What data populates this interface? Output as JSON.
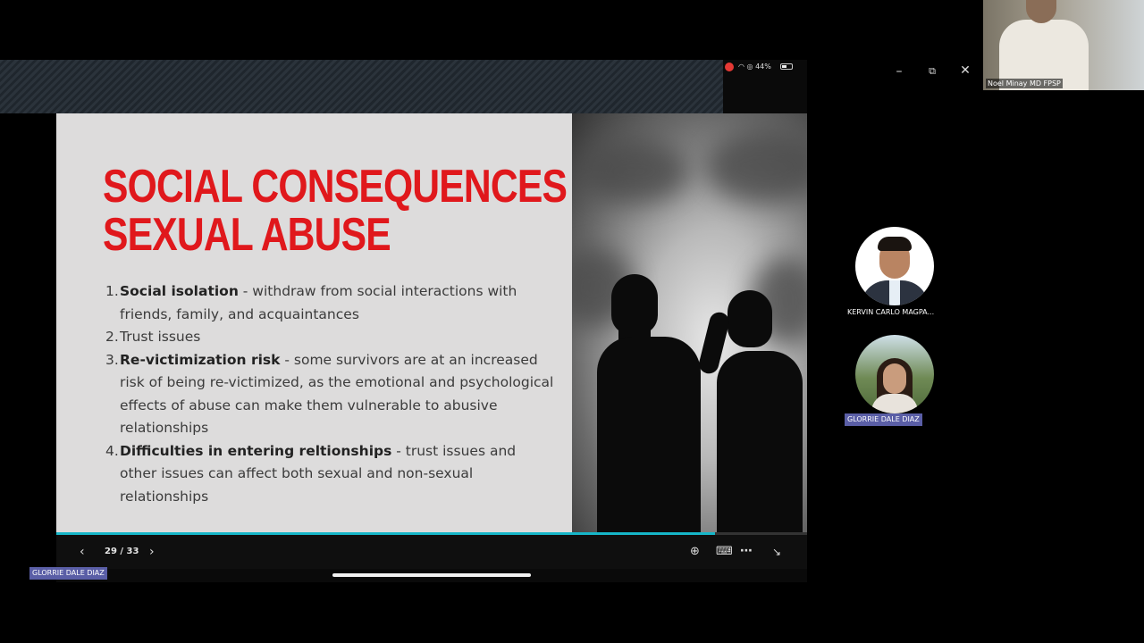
{
  "status_bar": {
    "text": "44%"
  },
  "slide": {
    "title_line1": "SOCIAL CONSEQUENCES OF",
    "title_line2": "SEXUAL ABUSE",
    "items": [
      {
        "num": "1.",
        "bold": "Social isolation",
        "text": " - withdraw from social interactions with friends, family, and acquaintances"
      },
      {
        "num": "2.",
        "bold": "",
        "text": "Trust issues"
      },
      {
        "num": "3.",
        "bold": "Re-victimization risk",
        "text": " - some survivors are at an increased risk of being re-victimized, as the emotional and psychological effects of abuse can make them vulnerable to abusive  relationships"
      },
      {
        "num": "4.",
        "bold": "Difficulties in entering reltionships",
        "text": " - trust issues and other issues can affect both sexual and non-sexual relationships"
      }
    ]
  },
  "presenter_controls": {
    "page_counter": "29 / 33",
    "progress": 0.877,
    "icons": [
      "chevron-left-icon",
      "chevron-right-icon",
      "zoom-in-icon",
      "keyboard-icon",
      "more-icon",
      "collapse-icon"
    ]
  },
  "screen_share_name_tag": "GLORRIE DALE DIAZ",
  "meeting": {
    "window_controls": [
      "minimize-icon",
      "restore-icon",
      "close-icon"
    ],
    "active_speaker_name": "Noel Minay MD FPSP",
    "participants": [
      {
        "name": "KERVIN CARLO MAGPA...",
        "highlighted": false
      },
      {
        "name": "GLORRIE DALE DIAZ",
        "highlighted": true
      }
    ]
  },
  "colors": {
    "title_red": "#e0181c",
    "progress": "#16b6c8",
    "name_tag": "#5a5ea6"
  }
}
